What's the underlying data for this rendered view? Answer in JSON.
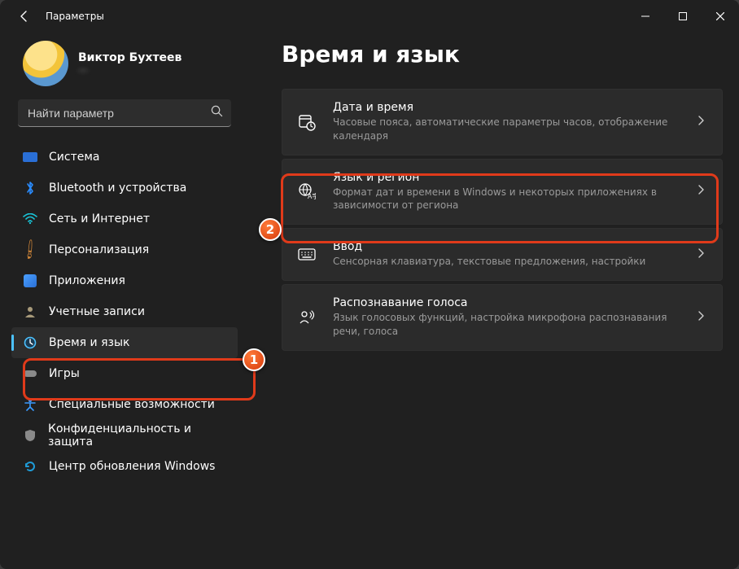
{
  "titlebar": {
    "title": "Параметры"
  },
  "profile": {
    "name": "Виктор Бухтеев",
    "sub": "—"
  },
  "search": {
    "placeholder": "Найти параметр"
  },
  "nav": [
    {
      "label": "Система"
    },
    {
      "label": "Bluetooth и устройства"
    },
    {
      "label": "Сеть и Интернет"
    },
    {
      "label": "Персонализация"
    },
    {
      "label": "Приложения"
    },
    {
      "label": "Учетные записи"
    },
    {
      "label": "Время и язык"
    },
    {
      "label": "Игры"
    },
    {
      "label": "Специальные возможности"
    },
    {
      "label": "Конфиденциальность и защита"
    },
    {
      "label": "Центр обновления Windows"
    }
  ],
  "page": {
    "title": "Время и язык"
  },
  "cards": [
    {
      "title": "Дата и время",
      "sub": "Часовые пояса, автоматические параметры часов, отображение календаря"
    },
    {
      "title": "Язык и регион",
      "sub": "Формат дат и времени в Windows и некоторых приложениях в зависимости от региона"
    },
    {
      "title": "Ввод",
      "sub": "Сенсорная клавиатура, текстовые предложения, настройки"
    },
    {
      "title": "Распознавание голоса",
      "sub": "Язык голосовых функций, настройка микрофона распознавания речи, голоса"
    }
  ],
  "markers": {
    "m1": "1",
    "m2": "2"
  }
}
